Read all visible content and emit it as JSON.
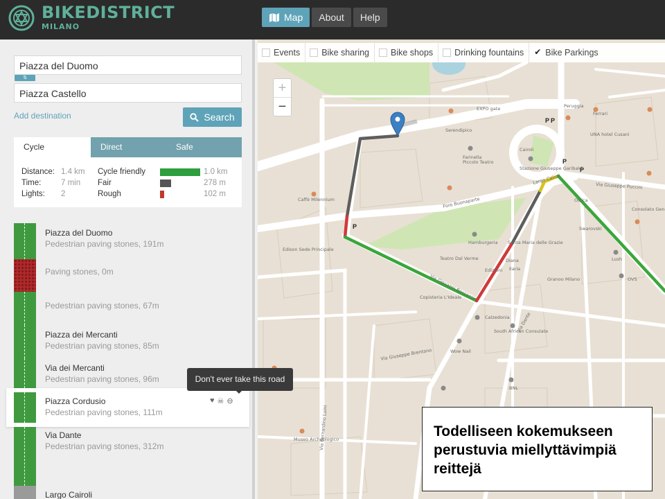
{
  "brand": {
    "name": "BIKEDISTRICT",
    "city": "MILANO"
  },
  "nav": [
    {
      "label": "Map",
      "active": true
    },
    {
      "label": "About",
      "active": false
    },
    {
      "label": "Help",
      "active": false
    }
  ],
  "route": {
    "origin": "Piazza del Duomo",
    "destination": "Piazza Castello",
    "swap_label": "⇅",
    "add_destination": "Add destination",
    "search_label": "Search"
  },
  "tabs": [
    {
      "label": "Cycle",
      "active": true
    },
    {
      "label": "Direct",
      "active": false
    },
    {
      "label": "Safe",
      "active": false
    }
  ],
  "stats": {
    "distance_label": "Distance:",
    "distance": "1.4 km",
    "time_label": "Time:",
    "time": "7 min",
    "lights_label": "Lights:",
    "lights": "2",
    "kinds": [
      {
        "label": "Cycle friendly",
        "length": "1.0 km",
        "color": "#2e9e3e",
        "fraction": 1.0
      },
      {
        "label": "Fair",
        "length": "278 m",
        "color": "#555555",
        "fraction": 0.27
      },
      {
        "label": "Rough",
        "length": "102 m",
        "color": "#c0392b",
        "fraction": 0.1
      }
    ]
  },
  "steps": [
    {
      "title": "Piazza del Duomo",
      "desc": "Pedestrian paving stones, 191m",
      "color": "#3f9a3f"
    },
    {
      "title": "",
      "desc": "Paving stones, 0m",
      "color": "#b0282a"
    },
    {
      "title": "",
      "desc": "Pedestrian paving stones, 67m",
      "color": "#3f9a3f"
    },
    {
      "title": "Piazza dei Mercanti",
      "desc": "Pedestrian paving stones, 85m",
      "color": "#3f9a3f"
    },
    {
      "title": "Via dei Mercanti",
      "desc": "Pedestrian paving stones, 96m",
      "color": "#3f9a3f"
    },
    {
      "title": "Piazza Cordusio",
      "desc": "Pedestrian paving stones, 111m",
      "color": "#3f9a3f"
    },
    {
      "title": "Via Dante",
      "desc": "Pedestrian paving stones, 312m",
      "color": "#3f9a3f"
    },
    {
      "title": "Largo Cairoli",
      "desc": "",
      "color": "#9a9a9a"
    }
  ],
  "tooltip": "Don't ever take this road",
  "filters": [
    {
      "label": "Events",
      "checked": false
    },
    {
      "label": "Bike sharing",
      "checked": false
    },
    {
      "label": "Bike shops",
      "checked": false
    },
    {
      "label": "Drinking fountains",
      "checked": false
    },
    {
      "label": "Bike Parkings",
      "checked": true
    }
  ],
  "map": {
    "streets": [
      "Foro Buonaparte",
      "Via Giovanni Boccaccio",
      "Via Giuseppe Brentano",
      "Largo Cairoli",
      "Via Giuseppe Puccini",
      "Via Dante",
      "Via Bernardino Luini"
    ],
    "places": [
      "Caffè Milennium",
      "Edison Sede Principale",
      "Copisteria L'Ideale",
      "Teatro Dal Verme",
      "Hamburgeria",
      "Santa Maria delle Grazie",
      "EXPO gate",
      "Piccolo Teatro",
      "Museo Archeologico",
      "Serendipico",
      "Farinella",
      "Stazione Giuseppe Garibaldi",
      "Peruggia",
      "Ottica",
      "Swarovski",
      "Consolato Generale di Algeria",
      "Diana",
      "Lush",
      "Wow Nail",
      "South African Consulate",
      "BNL",
      "Granoo Milano",
      "Calzedonia",
      "Edizioni",
      "Ilaria",
      "OVS",
      "Ferrari",
      "UNA hotel Cusani",
      "Cairoli"
    ],
    "zoom_in": "+",
    "zoom_out": "−",
    "parking_label": "P"
  },
  "caption": "Todelliseen kokemukseen perustuvia miellyttävimpiä reittejä",
  "colors": {
    "accent": "#5fa3b8",
    "route_good": "#3aa63a",
    "route_fair": "#555555",
    "route_bad": "#d33a3a",
    "route_warn": "#d8c21a",
    "marker": "#3b7fc4"
  }
}
